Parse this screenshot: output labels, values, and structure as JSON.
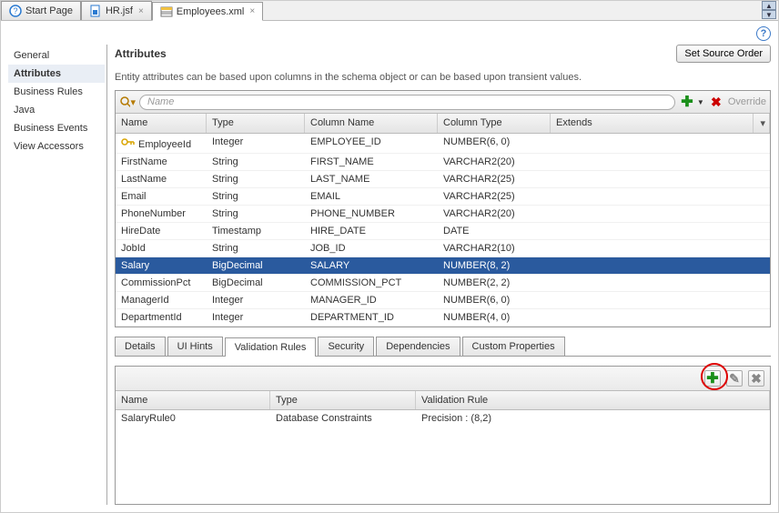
{
  "tabs": [
    {
      "label": "Start Page",
      "icon": "help-circle"
    },
    {
      "label": "HR.jsf",
      "icon": "file-blue"
    },
    {
      "label": "Employees.xml",
      "icon": "entity"
    }
  ],
  "active_tab": 2,
  "sidebar": {
    "items": [
      "General",
      "Attributes",
      "Business Rules",
      "Java",
      "Business Events",
      "View Accessors"
    ],
    "selected": 1
  },
  "header": {
    "title": "Attributes",
    "source_order_btn": "Set Source Order",
    "description": "Entity attributes can be based upon columns in the schema object or can be based upon transient values."
  },
  "toolbar": {
    "search_placeholder": "Name",
    "override_label": "Override"
  },
  "grid": {
    "columns": [
      "Name",
      "Type",
      "Column Name",
      "Column Type",
      "Extends"
    ],
    "selected": 7,
    "rows": [
      {
        "name": "EmployeeId",
        "type": "Integer",
        "col": "EMPLOYEE_ID",
        "ctype": "NUMBER(6, 0)",
        "ext": "",
        "key": true
      },
      {
        "name": "FirstName",
        "type": "String",
        "col": "FIRST_NAME",
        "ctype": "VARCHAR2(20)",
        "ext": ""
      },
      {
        "name": "LastName",
        "type": "String",
        "col": "LAST_NAME",
        "ctype": "VARCHAR2(25)",
        "ext": ""
      },
      {
        "name": "Email",
        "type": "String",
        "col": "EMAIL",
        "ctype": "VARCHAR2(25)",
        "ext": ""
      },
      {
        "name": "PhoneNumber",
        "type": "String",
        "col": "PHONE_NUMBER",
        "ctype": "VARCHAR2(20)",
        "ext": ""
      },
      {
        "name": "HireDate",
        "type": "Timestamp",
        "col": "HIRE_DATE",
        "ctype": "DATE",
        "ext": ""
      },
      {
        "name": "JobId",
        "type": "String",
        "col": "JOB_ID",
        "ctype": "VARCHAR2(10)",
        "ext": ""
      },
      {
        "name": "Salary",
        "type": "BigDecimal",
        "col": "SALARY",
        "ctype": "NUMBER(8, 2)",
        "ext": ""
      },
      {
        "name": "CommissionPct",
        "type": "BigDecimal",
        "col": "COMMISSION_PCT",
        "ctype": "NUMBER(2, 2)",
        "ext": ""
      },
      {
        "name": "ManagerId",
        "type": "Integer",
        "col": "MANAGER_ID",
        "ctype": "NUMBER(6, 0)",
        "ext": ""
      },
      {
        "name": "DepartmentId",
        "type": "Integer",
        "col": "DEPARTMENT_ID",
        "ctype": "NUMBER(4, 0)",
        "ext": ""
      }
    ]
  },
  "subtabs": {
    "items": [
      "Details",
      "UI Hints",
      "Validation Rules",
      "Security",
      "Dependencies",
      "Custom Properties"
    ],
    "active": 2
  },
  "rules": {
    "columns": [
      "Name",
      "Type",
      "Validation Rule"
    ],
    "rows": [
      {
        "name": "SalaryRule0",
        "type": "Database Constraints",
        "rule": "Precision : (8,2)"
      }
    ]
  }
}
